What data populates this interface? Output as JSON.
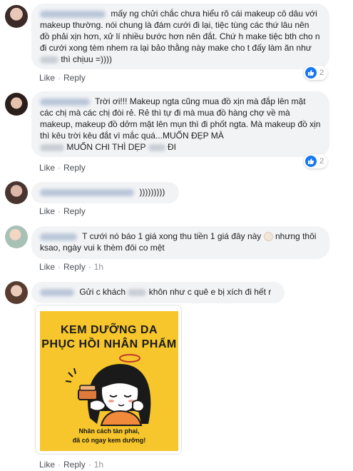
{
  "actions": {
    "like": "Like",
    "reply": "Reply",
    "separator": "·"
  },
  "comments": [
    {
      "text": "mấy ng chửi chắc chưa hiểu rõ cái makeup cô dâu với makeup thường. nói chung là đám cưới đi lại, tiệc tùng các thứ lâu nên đồ phải xịn hơn, xử lí nhiều bước hơn nên đắt. Chứ h make tiệc bth cho n đi cưới xong tèm nhem ra lại bảo thằng này make cho t đấy làm ăn như",
      "text_tail": "thì chịuu =))))",
      "reaction_count": "2",
      "time": ""
    },
    {
      "text": "Trời ơi!!! Makeup ngta cũng mua đồ xịn mà đắp lên mặt các chị mà các chị đòi rẻ. Rẻ thì tự đi mà mua đồ hàng chợ về mà makeup, makeup đồ dởm mặt lên mụn thì đi phốt ngta. Mà makeup đồ xịn thì kêu trời kêu đắt vì mắc quá...MUỐN ĐẸP MÀ",
      "text_mid": "MUỐN CHI THÌ DẸP",
      "text_tail": "ĐI",
      "reaction_count": "2",
      "time": ""
    },
    {
      "text": ")))))))))",
      "time": ""
    },
    {
      "text": "T cưới nó báo 1 giá xong thu tiền 1 giá đây này",
      "text_tail": "nhưng thôi ksao, ngày vui k thèm đôi co mệt",
      "time": "1h"
    },
    {
      "text": "Gửi c khách",
      "text_tail": "khôn như c quê e bị xích đi hết r",
      "time": "1h"
    }
  ],
  "sticker": {
    "title_line1": "KEM DƯỠNG DA",
    "title_line2": "PHỤC HỒI NHÂN PHẨM",
    "caption_line1": "Nhân cách tàn phai,",
    "caption_line2": "đã có ngay kem dưỡng!",
    "time": "1h"
  },
  "colors": {
    "bubble": "#f2f3f5",
    "like_blue": "#1877f2",
    "sticker_bg": "#f6c62c"
  }
}
